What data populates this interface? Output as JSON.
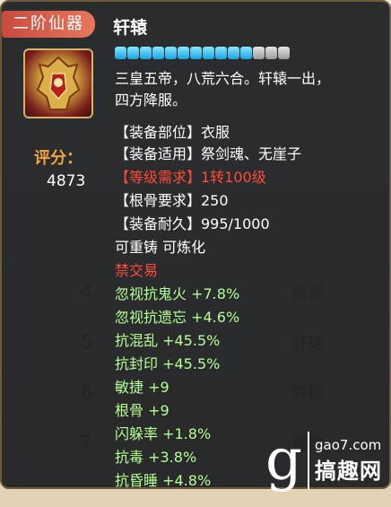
{
  "item": {
    "grade_tag": "二阶仙器",
    "name": "轩辕",
    "bar": {
      "filled": 11,
      "total": 14
    },
    "description_line1": "三皇五帝，八荒六合。轩辕一出，",
    "description_line2": "四方降服。",
    "slot": "【装备部位】衣服",
    "applicable": "【装备适用】祭剑魂、无崖子",
    "level_req": "【等级需求】1转100级",
    "root_req": "【根骨要求】250",
    "durability": "【装备耐久】995/1000",
    "flags": "可重铸 可炼化",
    "trade": "禁交易",
    "attributes": [
      "忽视抗鬼火 +7.8%",
      "忽视抗遗忘 +4.6%",
      "抗混乱 +45.5%",
      "抗封印 +45.5%",
      "敏捷 +9",
      "根骨 +9",
      "闪躲率 +1.8%",
      "抗毒 +3.8%",
      "抗昏睡 +4.8%"
    ]
  },
  "score": {
    "label": "评分：",
    "value": "4873"
  },
  "background": {
    "rows": [
      {
        "num": "4",
        "name": "舞雪"
      },
      {
        "num": "5",
        "name": "轩辕"
      },
      {
        "num": "6",
        "name": "轩辕"
      },
      {
        "num": "7",
        "name": "舞雪"
      }
    ]
  },
  "watermark": {
    "logo_letter": "g",
    "site": "gao7.com",
    "name": "搞趣网"
  }
}
